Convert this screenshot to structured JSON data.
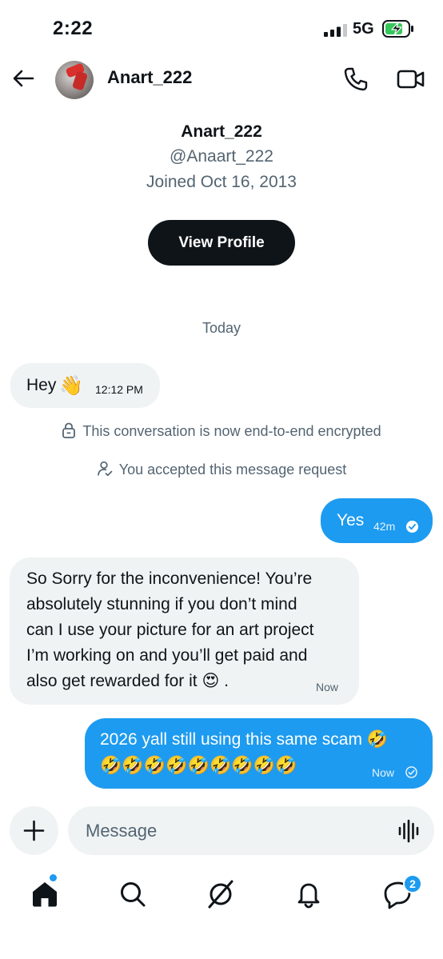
{
  "status_bar": {
    "time": "2:22",
    "network": "5G",
    "signal_icon": "cellular-signal-icon",
    "battery_icon": "battery-charging-icon",
    "battery_color": "#34c759"
  },
  "header": {
    "name": "Anart_222",
    "back_icon": "arrow-left-icon",
    "call_icon": "phone-icon",
    "video_icon": "video-camera-icon"
  },
  "profile": {
    "name": "Anart_222",
    "handle": "@Anaart_222",
    "joined": "Joined Oct 16, 2013",
    "view_profile_label": "View Profile"
  },
  "conversation": {
    "date_divider": "Today",
    "system_messages": [
      {
        "text": "This conversation is now end-to-end encrypted",
        "icon": "lock-icon"
      },
      {
        "text": "You accepted this message request",
        "icon": "person-check-icon"
      }
    ],
    "messages": [
      {
        "direction": "incoming",
        "text": "Hey",
        "emoji": "👋",
        "time": "12:12 PM"
      },
      {
        "direction": "outgoing",
        "text": "Yes",
        "time": "42m",
        "status_icon": "check-filled-icon"
      },
      {
        "direction": "incoming",
        "lines": [
          "So Sorry for the inconvenience! You’re",
          "absolutely stunning if you don’t mind",
          "can I use your picture for an art project",
          "I’m working on and you’ll get paid and",
          "also get rewarded for it 😍 ."
        ],
        "time": "Now"
      },
      {
        "direction": "outgoing",
        "line1": "2026 yall still using this same scam 🤣",
        "line2": "🤣🤣🤣🤣🤣🤣🤣🤣🤣",
        "time": "Now",
        "status_icon": "check-outline-icon"
      }
    ]
  },
  "composer": {
    "placeholder": "Message",
    "plus_icon": "plus-icon",
    "voice_icon": "voice-waveform-icon"
  },
  "bottom_nav": {
    "items": [
      {
        "name": "home",
        "icon": "home-icon",
        "active": true
      },
      {
        "name": "search",
        "icon": "search-icon"
      },
      {
        "name": "grok",
        "icon": "grok-icon"
      },
      {
        "name": "notifications",
        "icon": "bell-icon"
      },
      {
        "name": "messages",
        "icon": "message-bubble-icon"
      }
    ],
    "messages_badge": "2"
  },
  "colors": {
    "accent": "#1d9bf0",
    "text_primary": "#0f1419",
    "text_secondary": "#536471",
    "bubble_incoming": "#eff3f4"
  }
}
